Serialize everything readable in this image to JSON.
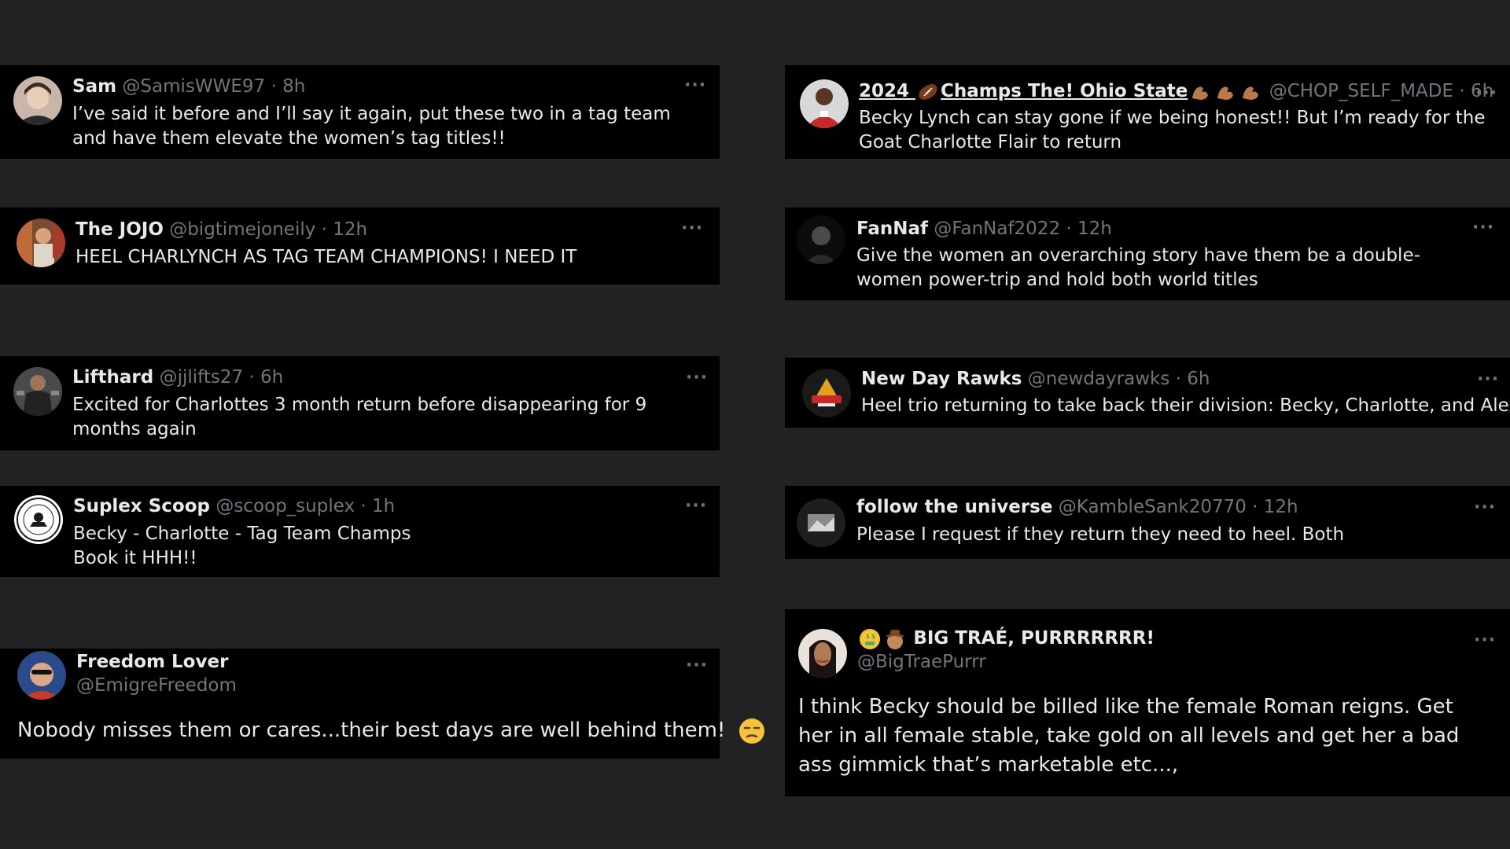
{
  "tweets": [
    {
      "name": "Sam",
      "handle": "@SamisWWE97",
      "time": "· 8h",
      "text": "I’ve said it before and I’ll say it again, put these two in a tag team and have them elevate the women’s tag titles!!"
    },
    {
      "name": "The JOJO",
      "handle": "@bigtimejoneily",
      "time": "· 12h",
      "text": "HEEL CHARLYNCH AS TAG TEAM CHAMPIONS! I NEED IT"
    },
    {
      "name": "Lifthard",
      "handle": "@jjlifts27",
      "time": "· 6h",
      "text": "Excited for Charlottes 3 month return before disappearing for 9 months again"
    },
    {
      "name": "Suplex Scoop",
      "handle": "@scoop_suplex",
      "time": "· 1h",
      "text_line1": "Becky - Charlotte - Tag Team Champs",
      "text_line2": "Book it HHH!!"
    },
    {
      "name": "Freedom Lover",
      "handle": "@EmigreFreedom",
      "text": "Nobody misses them or cares...their best days are well behind them!"
    },
    {
      "name_part1": "2024",
      "name_part2": "Champs The! Ohio State",
      "handle": "@CHOP_SELF_MADE",
      "time": "· 6h",
      "text": "Becky Lynch can stay gone if we being honest!! But I’m ready for the Goat Charlotte Flair to return"
    },
    {
      "name": "FanNaf",
      "handle": "@FanNaf2022",
      "time": "· 12h",
      "text": "Give the women an overarching story have them be a double-women power-trip and hold both world titles"
    },
    {
      "name": "New Day Rawks",
      "handle": "@newdayrawks",
      "time": "· 6h",
      "text": "Heel trio returning to take back their division: Becky, Charlotte, and Alexa"
    },
    {
      "name": "follow the universe",
      "handle": "@KambleSank20770",
      "time": "· 12h",
      "text": "Please I request if they return they need to heel. Both"
    },
    {
      "name": "BIG TRAÉ, PURRRRRRR!",
      "handle": "@BigTraePurrr",
      "text": "I think Becky should be billed like the female Roman reigns. Get her in all female stable, take gold on all levels and get her a bad ass gimmick that’s marketable etc...,"
    }
  ],
  "more_label": "···",
  "icons": {
    "more": "more-icon",
    "football": "football-icon",
    "flexed_biceps": "flexed-biceps-icon",
    "money_face": "money-mouth-face-icon",
    "cowboy": "cowboy-face-icon",
    "unamused": "unamused-face-icon"
  }
}
